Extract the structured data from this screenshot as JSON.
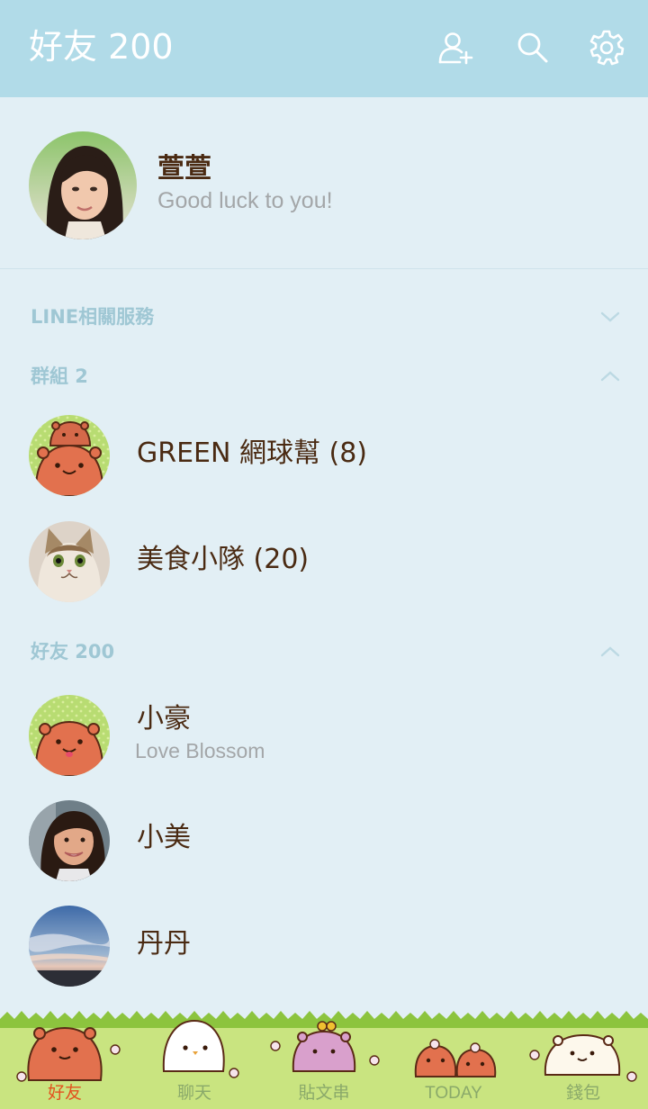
{
  "header": {
    "title": "好友 200",
    "icons": [
      "add-friend-icon",
      "search-icon",
      "settings-gear-icon"
    ],
    "bg_color": "#b1dbe8"
  },
  "profile": {
    "name": "萱萱",
    "status": "Good luck to you!"
  },
  "sections": {
    "services": {
      "label": "LINE相關服務",
      "expanded": false
    },
    "groups": {
      "label": "群組 2",
      "expanded": true,
      "items": [
        {
          "name": "GREEN 網球幫 (8)",
          "avatar": "capybara-group-avatar"
        },
        {
          "name": "美食小隊 (20)",
          "avatar": "cat-photo-avatar"
        }
      ]
    },
    "friends": {
      "label": "好友 200",
      "expanded": true,
      "items": [
        {
          "name": "小豪",
          "status": "Love Blossom",
          "avatar": "capybara-avatar"
        },
        {
          "name": "小美",
          "avatar": "woman-photo-avatar"
        },
        {
          "name": "丹丹",
          "avatar": "sky-photo-avatar"
        }
      ]
    }
  },
  "tabs": [
    {
      "label": "好友",
      "active": true,
      "icon": "capybara-brown-icon"
    },
    {
      "label": "聊天",
      "active": false,
      "icon": "white-bird-icon"
    },
    {
      "label": "貼文串",
      "active": false,
      "icon": "capybara-purple-icon"
    },
    {
      "label": "TODAY",
      "active": false,
      "icon": "capybara-pair-icon"
    },
    {
      "label": "錢包",
      "active": false,
      "icon": "white-capybara-icon"
    }
  ],
  "colors": {
    "active_tab": "#e2521e",
    "inactive_tab": "#8aa96a",
    "text_primary": "#4a2a12",
    "section_label": "#9fc7d4"
  }
}
